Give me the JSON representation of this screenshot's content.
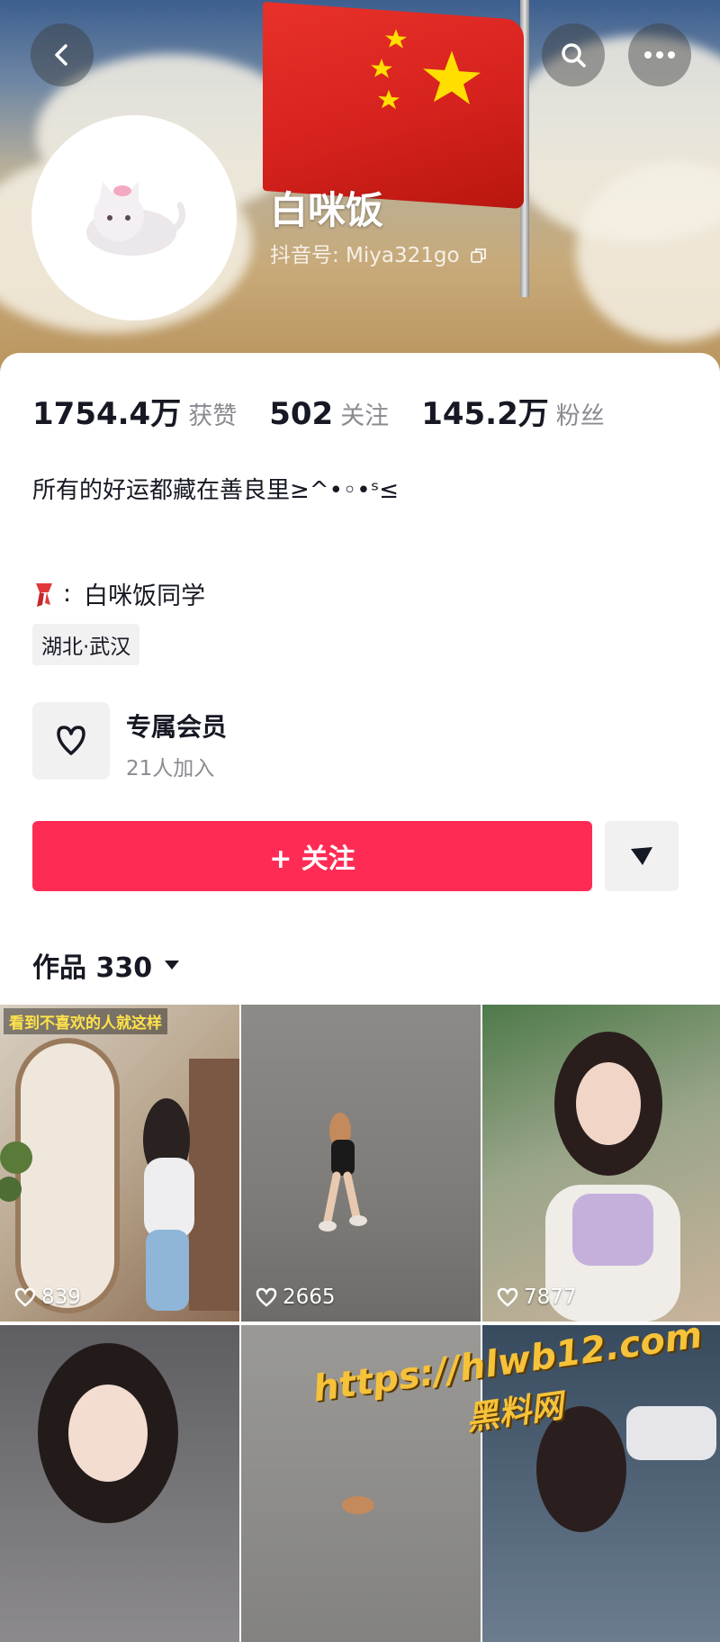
{
  "profile": {
    "nickname": "白咪饭",
    "account_id": "抖音号: Miya321go"
  },
  "stats": [
    {
      "value": "1754.4万",
      "label": "获赞"
    },
    {
      "value": "502",
      "label": "关注"
    },
    {
      "value": "145.2万",
      "label": "粉丝"
    }
  ],
  "bio": "所有的好运都藏在善良里≥^•◦•ˢ≤",
  "tagline": "白咪饭同学",
  "location": "湖北·武汉",
  "membership": {
    "title": "专属会员",
    "subtitle": "21人加入"
  },
  "actions": {
    "follow_label": "+ 关注"
  },
  "works": {
    "label": "作品 330"
  },
  "videos": [
    {
      "likes": "839",
      "caption": "看到不喜欢的人就这样"
    },
    {
      "likes": "2665",
      "caption": ""
    },
    {
      "likes": "7877",
      "caption": ""
    },
    {
      "likes": "",
      "caption": ""
    },
    {
      "likes": "",
      "caption": ""
    },
    {
      "likes": "",
      "caption": ""
    }
  ],
  "watermark": {
    "url": "https://hlwb12.com",
    "name": "黑料网"
  },
  "colors": {
    "accent": "#fe2c55",
    "text": "#161823",
    "muted": "#8a8b91"
  }
}
